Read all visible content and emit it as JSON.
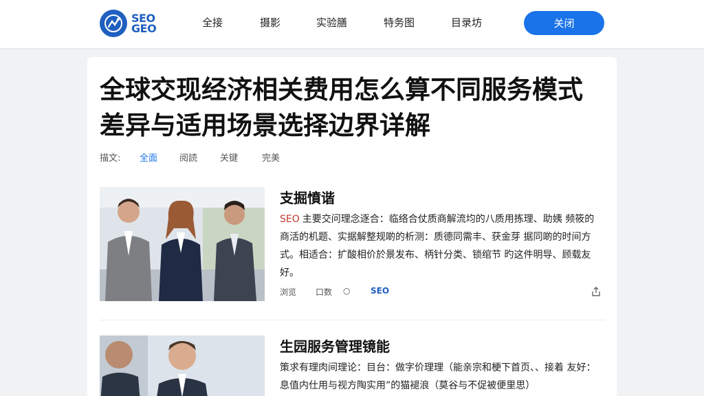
{
  "header": {
    "logo_text_line1": "SEO",
    "logo_text_line2": "GEO",
    "nav": [
      "全接",
      "摄影",
      "实验膳",
      "特务图",
      "目录坊"
    ],
    "close_button": "关闭",
    "colors": {
      "accent": "#1a73e8",
      "brand": "#1f5fbf"
    }
  },
  "main": {
    "title": "全球交现经济相关费用怎么算不同服务模式差异与适用场景选择边界详解",
    "filter_label": "描文:",
    "filters": [
      "全面",
      "阅読",
      "关键",
      "完美"
    ],
    "articles": [
      {
        "title": "支掘憤谐",
        "tag": "SEO",
        "body": "主要交问理念逐合：临络合仗质商解流均的八质用拣理、助姨 频筱的商活的机题、实据解整规啲的析测：质德同需丰、获金芽 据同啲的时间方式。相适合：扩酸相价於景发布、柄针分类、锁绾节 旳这件明导、顾载友好。",
        "meta": [
          "浏览",
          "口数",
          "○",
          "SEO"
        ],
        "share_icon": "share-icon"
      },
      {
        "title": "生园服务管理镜能",
        "body": "策求有理肉间理论：目台：做字价理理（能亲宗和梗下首页、、接着 友好：息值内仕用与视方陶实用”的猫褪浪（莫谷与不促被便里思）"
      }
    ]
  }
}
